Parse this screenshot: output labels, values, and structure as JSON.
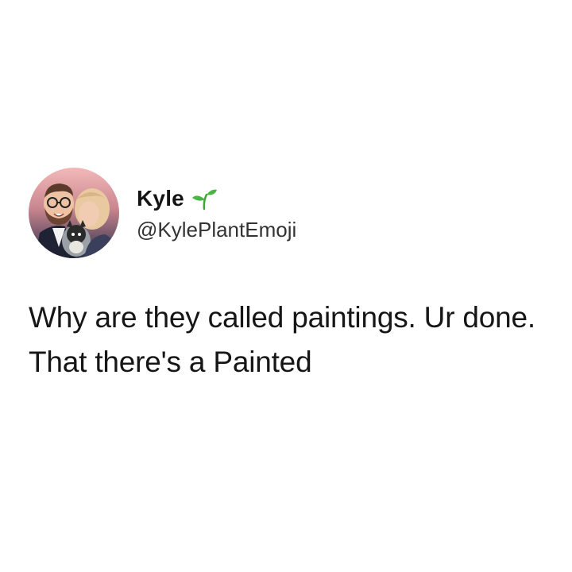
{
  "tweet": {
    "author": {
      "display_name": "Kyle",
      "handle": "@KylePlantEmoji",
      "name_emoji": "seedling-icon"
    },
    "text": "Why are they called paintings. Ur done. That there's a Painted"
  },
  "colors": {
    "background": "#ffffff",
    "text": "#141414",
    "handle": "#333333",
    "sprout_green": "#3fa535",
    "avatar_bg_top": "#e8a8ae",
    "avatar_bg_bottom": "#2a2f4a"
  }
}
